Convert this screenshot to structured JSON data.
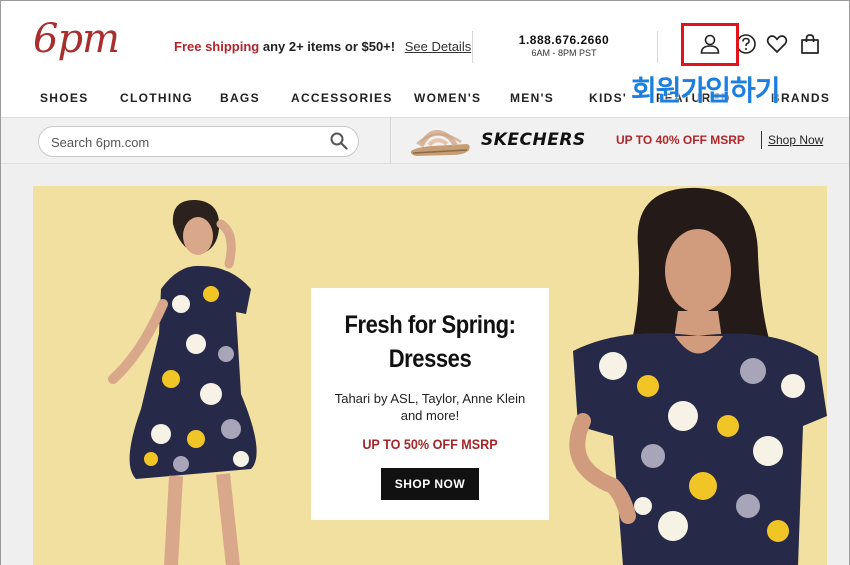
{
  "header": {
    "logo_text": "6pm",
    "promo": {
      "highlight": "Free shipping",
      "rest": "any 2+ items or $50+!",
      "link": "See Details"
    },
    "phone": {
      "number": "1.888.676.2660",
      "hours": "6AM - 8PM PST"
    },
    "icons": [
      "user-icon",
      "help-icon",
      "heart-icon",
      "shopping-bag-icon"
    ],
    "overlay_annotation": "회원가입하기"
  },
  "nav": {
    "items": [
      "SHOES",
      "CLOTHING",
      "BAGS",
      "ACCESSORIES",
      "WOMEN'S",
      "MEN'S",
      "KIDS'",
      "FEATURED",
      "BRANDS"
    ]
  },
  "search": {
    "placeholder": "Search 6pm.com"
  },
  "brand_banner": {
    "brand": "SKECHERS",
    "deal": "UP TO 40% OFF MSRP",
    "link": "Shop Now"
  },
  "hero": {
    "title_line1": "Fresh for Spring:",
    "title_line2": "Dresses",
    "subtitle": "Tahari by ASL, Taylor, Anne Klein and more!",
    "deal": "UP TO 50% OFF MSRP",
    "button": "SHOP NOW"
  },
  "colors": {
    "brand_red": "#b0272b",
    "hero_bg": "#f2e0a1",
    "highlight_red": "#e2131b",
    "annotation_blue": "#1a7fe0"
  }
}
